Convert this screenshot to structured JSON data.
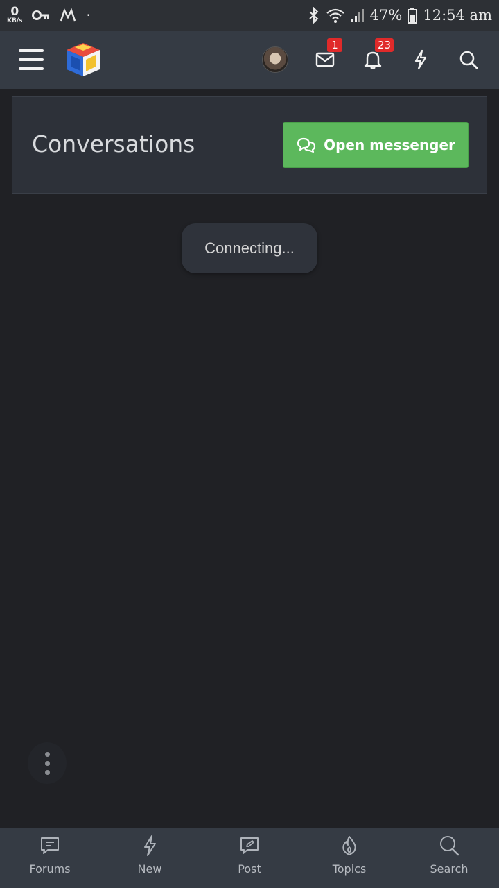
{
  "status_bar": {
    "speed_value": "0",
    "speed_unit": "KB/s",
    "battery": "47%",
    "time": "12:54 am",
    "icons": [
      "key-icon",
      "vpn-icon",
      "dot-icon",
      "bluetooth-icon",
      "wifi-icon",
      "signal-icon",
      "battery-icon"
    ]
  },
  "topnav": {
    "messages_badge": "1",
    "alerts_badge": "23",
    "icons": [
      "menu-icon",
      "site-logo",
      "avatar",
      "envelope-icon",
      "bell-icon",
      "bolt-icon",
      "search-icon"
    ]
  },
  "page": {
    "title": "Conversations",
    "open_messenger_label": "Open messenger"
  },
  "toast": {
    "text": "Connecting..."
  },
  "tabbar": {
    "items": [
      {
        "label": "Forums",
        "icon": "forums-icon"
      },
      {
        "label": "New",
        "icon": "bolt-icon"
      },
      {
        "label": "Post",
        "icon": "edit-icon"
      },
      {
        "label": "Topics",
        "icon": "flame-icon"
      },
      {
        "label": "Search",
        "icon": "search-icon"
      }
    ]
  },
  "colors": {
    "background": "#202125",
    "nav": "#353b44",
    "card": "#2d3139",
    "accent_green": "#5cb85c",
    "badge_red": "#e02a2a"
  }
}
